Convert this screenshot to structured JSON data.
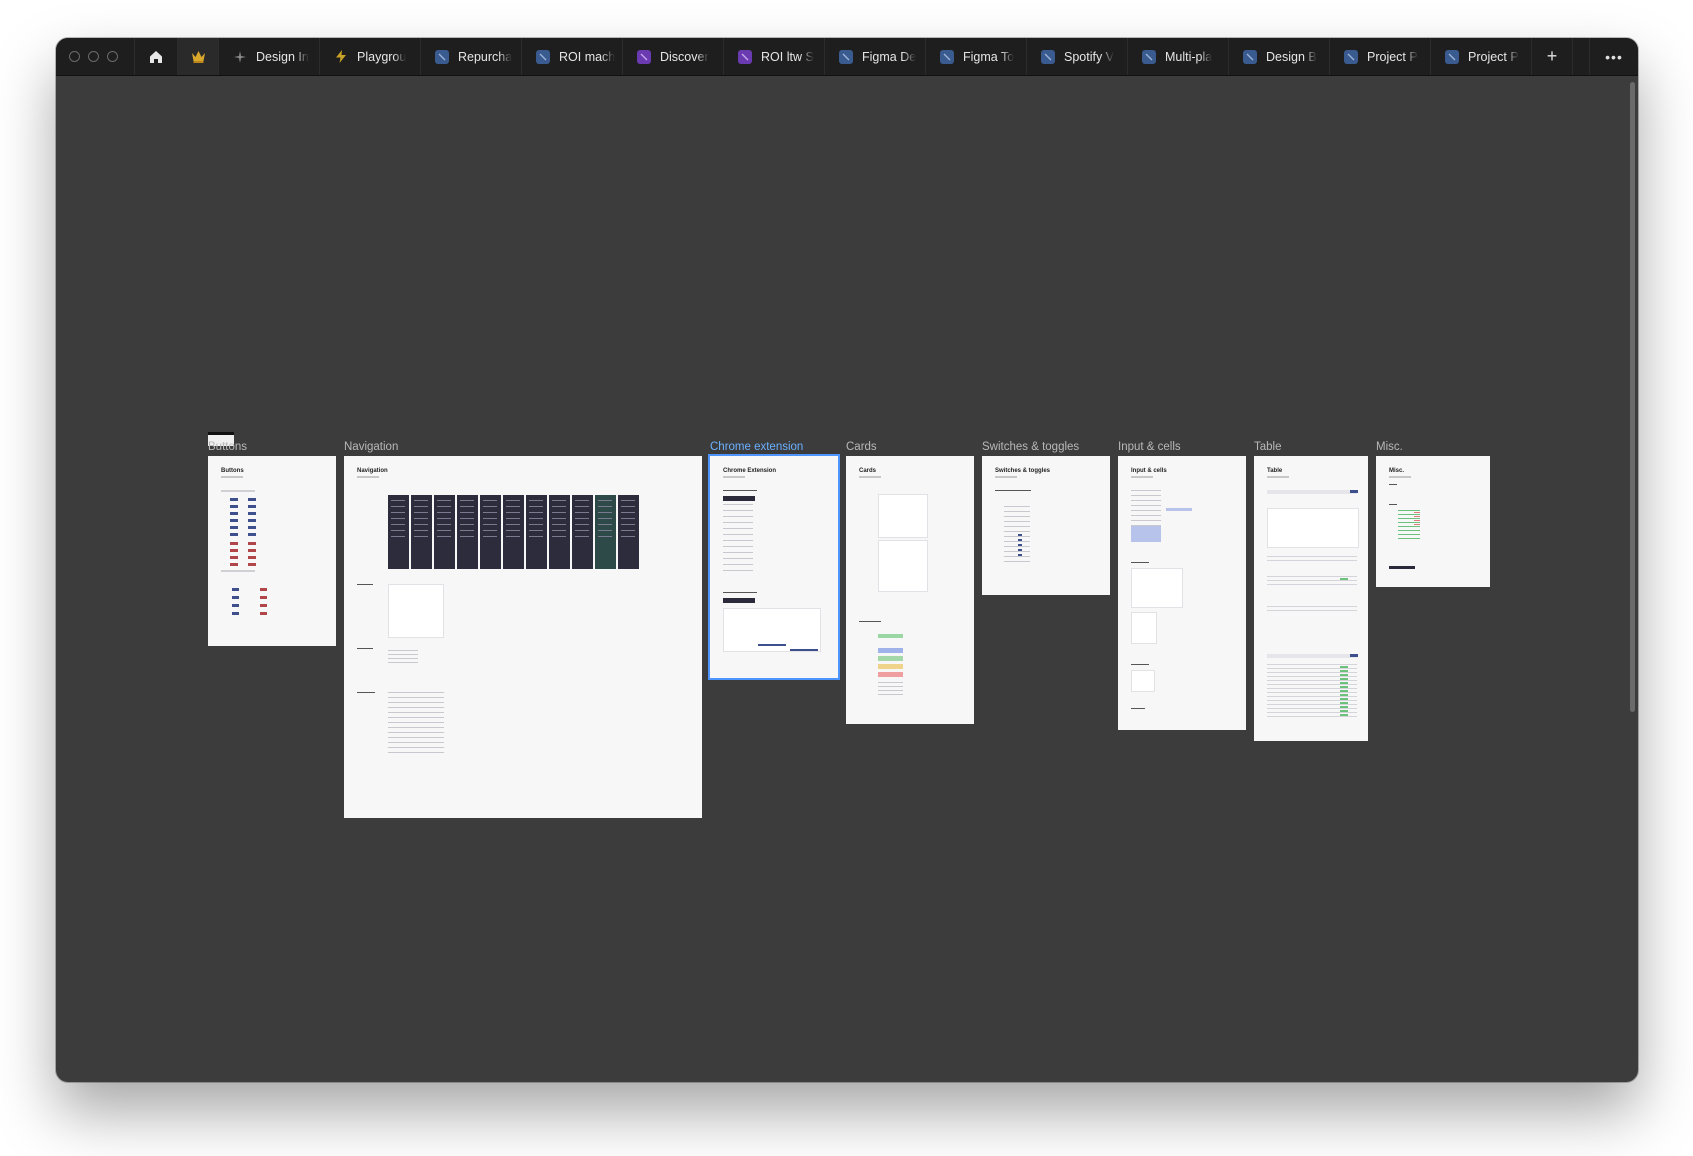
{
  "window": {
    "tabs": [
      {
        "label": "Design In",
        "icon": "sparkle-icon",
        "color": "#6e6e6e"
      },
      {
        "label": "Playgrou",
        "icon": "lightning-icon",
        "color": "#c9a227"
      },
      {
        "label": "Repurcha",
        "icon": "figma-file-icon",
        "color": "#3a5b8f"
      },
      {
        "label": "ROI mach",
        "icon": "figma-file-icon",
        "color": "#3a5b8f"
      },
      {
        "label": "Discover",
        "icon": "figma-file-icon",
        "color": "#6a3ab0"
      },
      {
        "label": "ROI ltw S",
        "icon": "figma-file-icon",
        "color": "#6a3ab0"
      },
      {
        "label": "Figma De",
        "icon": "figma-file-icon",
        "color": "#3a5b8f"
      },
      {
        "label": "Figma To",
        "icon": "figma-file-icon",
        "color": "#3a5b8f"
      },
      {
        "label": "Spotify V",
        "icon": "figma-file-icon",
        "color": "#3a5b8f"
      },
      {
        "label": "Multi-pla",
        "icon": "figma-file-icon",
        "color": "#3a5b8f"
      },
      {
        "label": "Design B",
        "icon": "figma-file-icon",
        "color": "#3a5b8f"
      },
      {
        "label": "Project P",
        "icon": "figma-file-icon",
        "color": "#3a5b8f"
      },
      {
        "label": "Project P",
        "icon": "figma-file-icon",
        "color": "#3a5b8f"
      }
    ],
    "new_tab_label": "+",
    "more_label": "•••"
  },
  "canvas": {
    "background": "#3c3c3c",
    "selected_color": "#4d94ff",
    "frames": [
      {
        "key": "buttons",
        "label": "Buttons",
        "title": "Buttons"
      },
      {
        "key": "navigation",
        "label": "Navigation",
        "title": "Navigation"
      },
      {
        "key": "chrome",
        "label": "Chrome extension",
        "title": "Chrome Extension",
        "selected": true
      },
      {
        "key": "cards",
        "label": "Cards",
        "title": "Cards"
      },
      {
        "key": "switches",
        "label": "Switches & toggles",
        "title": "Switches & toggles"
      },
      {
        "key": "inputs",
        "label": "Input & cells",
        "title": "Input & cells"
      },
      {
        "key": "table",
        "label": "Table",
        "title": "Table"
      },
      {
        "key": "misc",
        "label": "Misc.",
        "title": "Misc."
      }
    ]
  }
}
